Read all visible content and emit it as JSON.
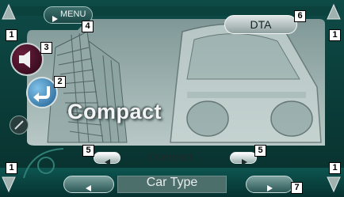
{
  "top": {
    "menu_label": "MENU",
    "dta_label": "DTA"
  },
  "main": {
    "title": "Compact",
    "value": "Compact"
  },
  "footer": {
    "label": "Car Type"
  },
  "callouts": {
    "c1_tl": "1",
    "c1_tr": "1",
    "c1_bl": "1",
    "c1_br": "1",
    "c2": "2",
    "c3": "3",
    "c4": "4",
    "c5_left": "5",
    "c5_right": "5",
    "c6": "6",
    "c7": "7"
  },
  "colors": {
    "screen_bg": "#0b3d3a",
    "panel_teal": "#9fb4b1",
    "accent_blue": "#3c7fb0",
    "callout_bg": "#ffffff"
  },
  "icons": {
    "speaker": "speaker-icon",
    "return": "return-arrow-icon",
    "pen": "pen-icon",
    "left": "left-arrow-icon",
    "right": "right-arrow-icon",
    "up": "up-arrow-icon",
    "down": "down-arrow-icon"
  }
}
